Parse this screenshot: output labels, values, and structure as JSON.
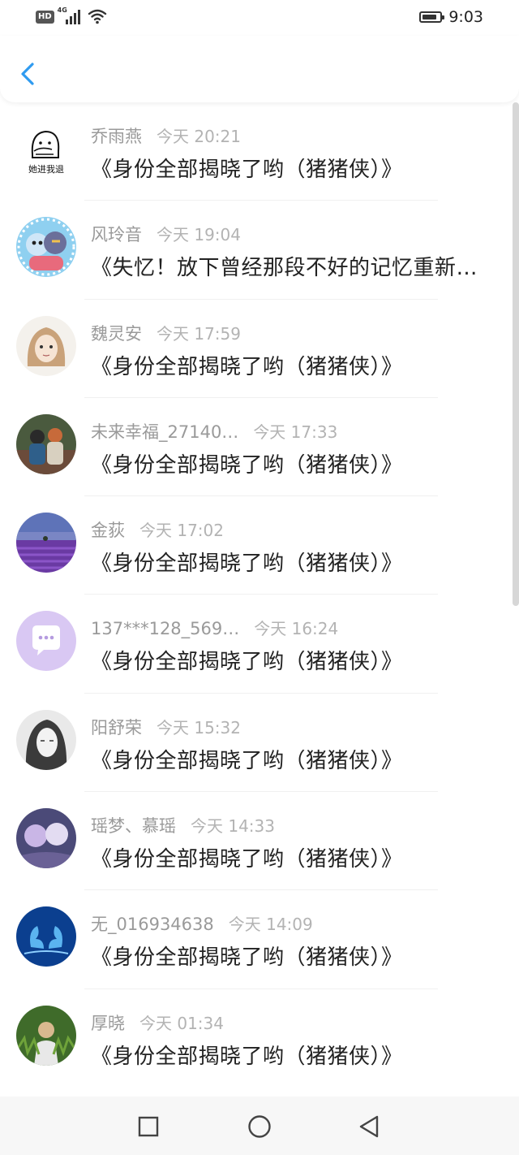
{
  "status_bar": {
    "network_badge": "HD",
    "network_type": "4G",
    "time": "9:03",
    "battery_level": 0.85
  },
  "messages": [
    {
      "name": "乔雨燕",
      "time": "今天 20:21",
      "title": "《身份全部揭晓了哟（猪猪侠）》",
      "avatar_icon": "cartoon-ghost-avatar",
      "avatar_text": "她进我退"
    },
    {
      "name": "风玲音",
      "time": "今天 19:04",
      "title": "《失忆！放下曾经那段不好的记忆重新…",
      "avatar_icon": "cartoon-characters-avatar"
    },
    {
      "name": "魏灵安",
      "time": "今天 17:59",
      "title": "《身份全部揭晓了哟（猪猪侠）》",
      "avatar_icon": "anime-girl-sketch-avatar"
    },
    {
      "name": "未来幸福_27140…",
      "time": "今天 17:33",
      "title": "《身份全部揭晓了哟（猪猪侠）》",
      "avatar_icon": "couple-photo-avatar"
    },
    {
      "name": "金荻",
      "time": "今天 17:02",
      "title": "《身份全部揭晓了哟（猪猪侠）》",
      "avatar_icon": "lavender-field-avatar"
    },
    {
      "name": "137***128_569…",
      "time": "今天 16:24",
      "title": "《身份全部揭晓了哟（猪猪侠）》",
      "avatar_icon": "chat-bubble-avatar"
    },
    {
      "name": "阳舒荣",
      "time": "今天 15:32",
      "title": "《身份全部揭晓了哟（猪猪侠）》",
      "avatar_icon": "ink-sketch-avatar"
    },
    {
      "name": "瑶梦、慕瑶",
      "time": "今天 14:33",
      "title": "《身份全部揭晓了哟（猪猪侠）》",
      "avatar_icon": "anime-couple-avatar"
    },
    {
      "name": "无_016934638",
      "time": "今天 14:09",
      "title": "《身份全部揭晓了哟（猪猪侠）》",
      "avatar_icon": "blue-swans-avatar"
    },
    {
      "name": "厚晓",
      "time": "今天 01:34",
      "title": "《身份全部揭晓了哟（猪猪侠）》",
      "avatar_icon": "grass-field-avatar"
    }
  ],
  "colors": {
    "accent": "#2f9bf0",
    "name_text": "#9a9a9a",
    "time_text": "#b3b3b3",
    "title_text": "#222222"
  }
}
